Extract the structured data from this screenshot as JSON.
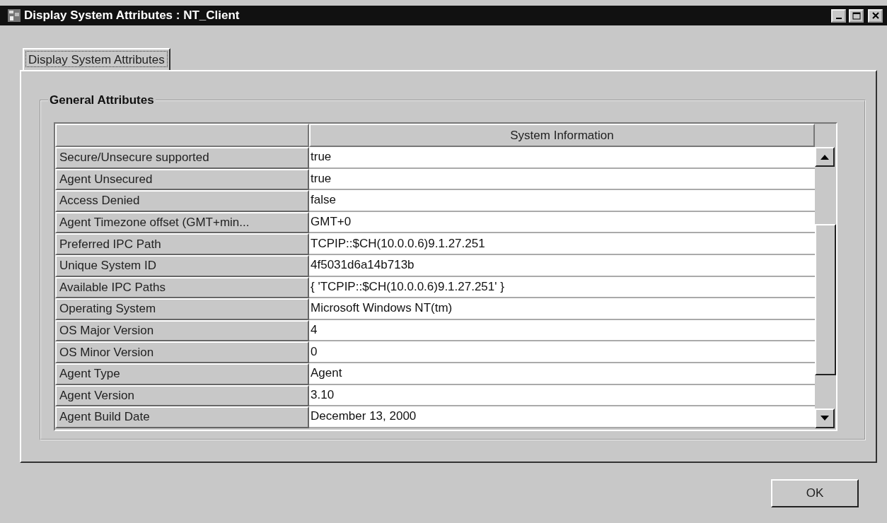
{
  "window": {
    "title": "Display System Attributes : NT_Client"
  },
  "tabs": [
    {
      "label": "Display System Attributes",
      "selected": true
    }
  ],
  "group": {
    "title": "General Attributes"
  },
  "table": {
    "columns": [
      "System Information"
    ],
    "rows": [
      {
        "name": "Secure/Unsecure supported",
        "value": "true"
      },
      {
        "name": "Agent Unsecured",
        "value": "true"
      },
      {
        "name": "Access Denied",
        "value": "false"
      },
      {
        "name": "Agent Timezone offset (GMT+min...",
        "value": "GMT+0"
      },
      {
        "name": "Preferred IPC Path",
        "value": "TCPIP::$CH(10.0.0.6)9.1.27.251"
      },
      {
        "name": "Unique System ID",
        "value": "4f5031d6a14b713b"
      },
      {
        "name": "Available IPC Paths",
        "value": "{ 'TCPIP::$CH(10.0.0.6)9.1.27.251' }"
      },
      {
        "name": "Operating System",
        "value": "Microsoft Windows NT(tm)"
      },
      {
        "name": "OS Major Version",
        "value": "4"
      },
      {
        "name": "OS Minor Version",
        "value": "0"
      },
      {
        "name": "Agent Type",
        "value": "Agent"
      },
      {
        "name": "Agent Version",
        "value": "3.10"
      },
      {
        "name": "Agent Build Date",
        "value": "December 13, 2000"
      }
    ]
  },
  "buttons": [
    {
      "label": "OK"
    }
  ]
}
